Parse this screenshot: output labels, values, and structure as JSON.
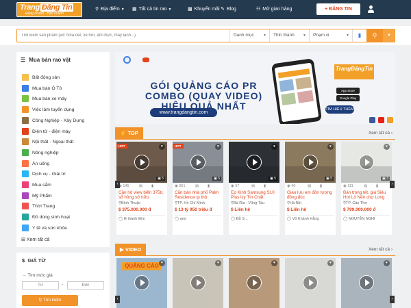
{
  "header": {
    "logo_main": "Trang",
    "logo_box": "Đăng Tin",
    "logo_tagline": "Đăng nhanh - Bán nhanh",
    "nav": [
      {
        "label": "Địa điểm",
        "icon": "map-pin-icon"
      },
      {
        "label": "Tất cả tin rao",
        "icon": "grid-icon"
      },
      {
        "label": "Khuyến mãi",
        "icon": "gift-icon"
      },
      {
        "label": "Blog",
        "icon": "blog-icon"
      },
      {
        "label": "Mở gian hàng",
        "icon": "cart-icon"
      }
    ],
    "post_button": "+ ĐĂNG TIN"
  },
  "search": {
    "placeholder": "Tìm kiếm sản phẩm (vd: Nhà đất, xe hơi, ẩm thực, máy lạnh...)",
    "category": "Danh mục",
    "province": "Tỉnh thành",
    "range": "Phạm vi"
  },
  "sidebar": {
    "title": "Mua bán rao vặt",
    "items": [
      {
        "label": "Bất động sản",
        "color": "#f2c14e"
      },
      {
        "label": "Mua bán Ô Tô",
        "color": "#3d7ee8"
      },
      {
        "label": "Mua bán xe máy",
        "color": "#7cc242"
      },
      {
        "label": "Việc làm tuyển dụng",
        "color": "#f29329"
      },
      {
        "label": "Công Nghiệp - Xây Dựng",
        "color": "#8b6f47"
      },
      {
        "label": "Điện tử - điện máy",
        "color": "#e2421a"
      },
      {
        "label": "Nội thất - Ngoại thất",
        "color": "#c98a3b"
      },
      {
        "label": "Nông nghiệp",
        "color": "#4caf50"
      },
      {
        "label": "Ăn uống",
        "color": "#ff7043"
      },
      {
        "label": "Dịch vụ - Giải trí",
        "color": "#29b6f6"
      },
      {
        "label": "Mua sắm",
        "color": "#ec407a"
      },
      {
        "label": "Mỹ Phẩm",
        "color": "#ab47bc"
      },
      {
        "label": "Thời Trang",
        "color": "#ef5350"
      },
      {
        "label": "Đồ dùng sinh hoạt",
        "color": "#26a69a"
      },
      {
        "label": "Y tế và sức khỏe",
        "color": "#42a5f5"
      }
    ],
    "see_all": "Xem tất cả"
  },
  "price_filter": {
    "title": "GIÁ TỪ",
    "subtitle": "Tìm mức giá",
    "from": "Từ",
    "to": "Đến",
    "button": "Tìm kiếm"
  },
  "banner": {
    "headline_1": "GÓI QUẢNG CÁO PR",
    "headline_2": "COMBO (QUAY VIDEO)",
    "headline_3": "HIỆU QUẢ NHẤT",
    "url": "www.trangdangtin.com",
    "logo": "TrangĐăngTin",
    "app_store": "App Store",
    "google_play": "Google Play",
    "more": "TÌM HIỂU THÊM"
  },
  "top_section": {
    "tag": "TOP",
    "see_all": "Xem tất cả",
    "cards": [
      {
        "hot": "HOT",
        "views": "145",
        "photos": "5",
        "title": "Căn hộ view biển 375tr, sổ hồng sở hữu",
        "location": "Bình Thuận",
        "price": "$ 375.000.000 đ",
        "user": "lê thành liêm",
        "img": "#6d5a4a"
      },
      {
        "hot": "HOT",
        "views": "951",
        "photos": "5",
        "title": "Căn bán nhà phố Palm Residence tp thủ",
        "location": "TP. Hồ Chí Minh",
        "price": "$ 13 tỷ 950 triệu đ",
        "user": "ami",
        "img": "#8a8f97"
      },
      {
        "hot": "",
        "views": "57",
        "photos": "5",
        "title": "Ép Kính Samsung S10 Plus Uy Tín Chất",
        "location": "Bà Rịa - Vũng Tàu",
        "price": "$ Liên hệ",
        "user": "Đỗ S...",
        "img": "#2d3136"
      },
      {
        "hot": "",
        "views": "40",
        "photos": "5",
        "title": "Giao lưu em đôn tượng đồng đúc",
        "location": "Hà Nội",
        "price": "$ Liên hệ",
        "user": "Võ Khánh Hằng",
        "img": "#8c7a5e"
      },
      {
        "hot": "",
        "views": "111",
        "photos": "3",
        "title": "Bán trong tết, giá Siêu Hời Lô Nền chợ Long Hòa,",
        "location": "TP. Cần Thơ",
        "price": "$ 799.000.000 đ",
        "user": "NGUYỄN NGHI",
        "img": "#e6e8e4"
      }
    ]
  },
  "video_section": {
    "tag": "VIDEO",
    "see_all": "Xem tất cả",
    "cards": [
      {
        "banner_text": "QUẢNG CÁO",
        "img": "#9bb7cf"
      },
      {
        "img": "#c9c4b8"
      },
      {
        "img": "#b89a7a"
      },
      {
        "img": "#d8d8d4"
      },
      {
        "img": "#a9b4bd"
      }
    ]
  }
}
